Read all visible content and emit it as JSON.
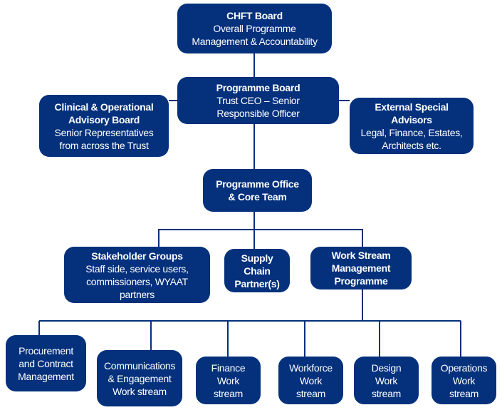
{
  "colors": {
    "box_fill": "#04307c",
    "line": "#04307c",
    "text": "#ffffff"
  },
  "nodes": {
    "chft": {
      "title": "CHFT Board",
      "lines": [
        "Overall Programme",
        "Management & Accountability"
      ]
    },
    "programme_board": {
      "title": "Programme Board",
      "lines": [
        "Trust CEO – Senior",
        "Responsible Officer"
      ]
    },
    "clinical": {
      "title_lines": [
        "Clinical & Operational",
        "Advisory Board"
      ],
      "lines": [
        "Senior Representatives",
        "from across the Trust"
      ]
    },
    "external": {
      "title_lines": [
        "External Special",
        "Advisors"
      ],
      "lines": [
        "Legal, Finance, Estates,",
        "Architects etc."
      ]
    },
    "office": {
      "title_lines": [
        "Programme Office",
        "& Core Team"
      ]
    },
    "stakeholder": {
      "title": "Stakeholder Groups",
      "lines": [
        "Staff side, service users,",
        "commissioners, WYAAT",
        "partners"
      ]
    },
    "supply": {
      "title_lines": [
        "Supply",
        "Chain",
        "Partner(s)"
      ]
    },
    "workstream_mgmt": {
      "title_lines": [
        "Work Stream",
        "Management",
        "Programme"
      ]
    },
    "procurement": {
      "lines": [
        "Procurement",
        "and Contract",
        "Management"
      ]
    },
    "comms": {
      "lines": [
        "Communications",
        "& Engagement",
        "Work stream"
      ]
    },
    "finance": {
      "lines": [
        "Finance",
        "Work",
        "stream"
      ]
    },
    "workforce": {
      "lines": [
        "Workforce",
        "Work",
        "stream"
      ]
    },
    "design": {
      "lines": [
        "Design",
        "Work",
        "stream"
      ]
    },
    "operations": {
      "lines": [
        "Operations",
        "Work",
        "stream"
      ]
    }
  }
}
